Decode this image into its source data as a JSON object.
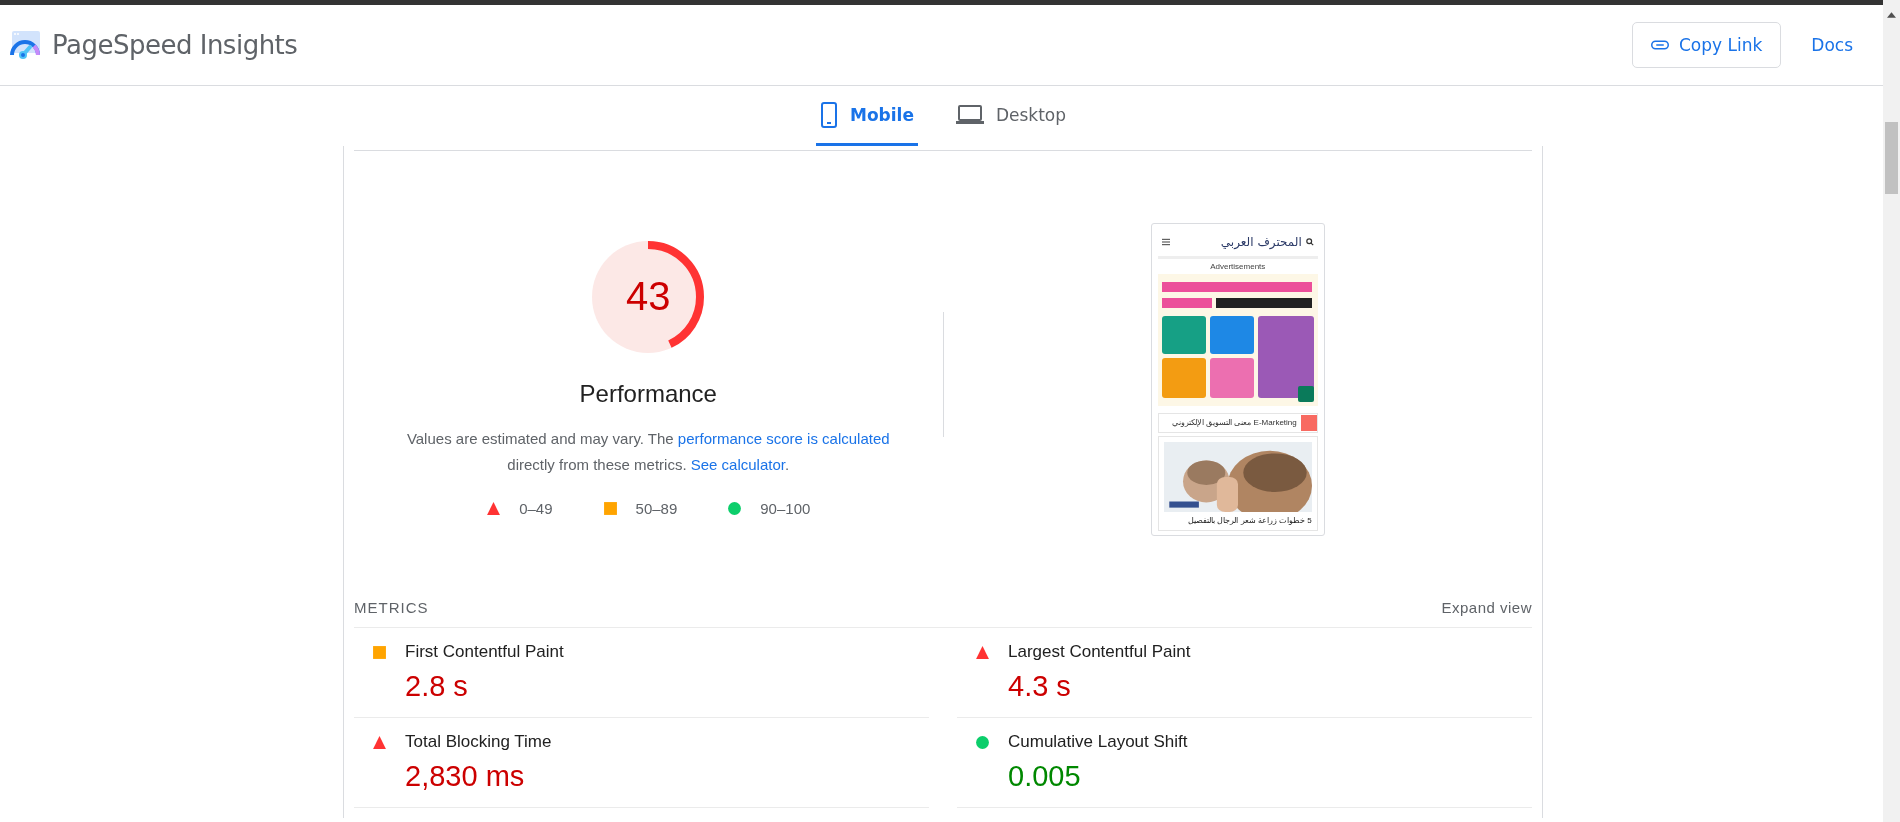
{
  "header": {
    "title": "PageSpeed Insights",
    "copy_link": "Copy Link",
    "docs": "Docs"
  },
  "tabs": [
    {
      "label": "Mobile",
      "kind": "phone",
      "selected": true
    },
    {
      "label": "Desktop",
      "kind": "laptop",
      "selected": false
    }
  ],
  "score": {
    "value": "43",
    "level": 0.43,
    "label": "Performance"
  },
  "description": {
    "lead": "Values are estimated and may vary. The ",
    "link1": "performance score is calculated",
    "middle": "directly from these metrics. ",
    "link2": "See calculator",
    "end": "."
  },
  "legend": [
    {
      "kind": "fail",
      "range": "0–49"
    },
    {
      "kind": "average",
      "range": "50–89"
    },
    {
      "kind": "pass",
      "range": "90–100"
    }
  ],
  "preview": {
    "site_title": "المحترف العربي",
    "ad_label": "Advertisements",
    "ticker": "معنى التسويق الإلكتروني E-Marketing",
    "headline": "5 خطوات زراعة شعر الرجال بالتفصيل"
  },
  "metrics_heading": "METRICS",
  "expand": "Expand view",
  "metrics": [
    {
      "label": "First Contentful Paint",
      "value": "2.8 s",
      "kind": "average",
      "color": "#cc0000"
    },
    {
      "label": "Largest Contentful Paint",
      "value": "4.3 s",
      "kind": "fail",
      "color": "#cc0000"
    },
    {
      "label": "Total Blocking Time",
      "value": "2,830 ms",
      "kind": "fail",
      "color": "#cc0000"
    },
    {
      "label": "Cumulative Layout Shift",
      "value": "0.005",
      "kind": "pass",
      "color": "#008800"
    }
  ]
}
